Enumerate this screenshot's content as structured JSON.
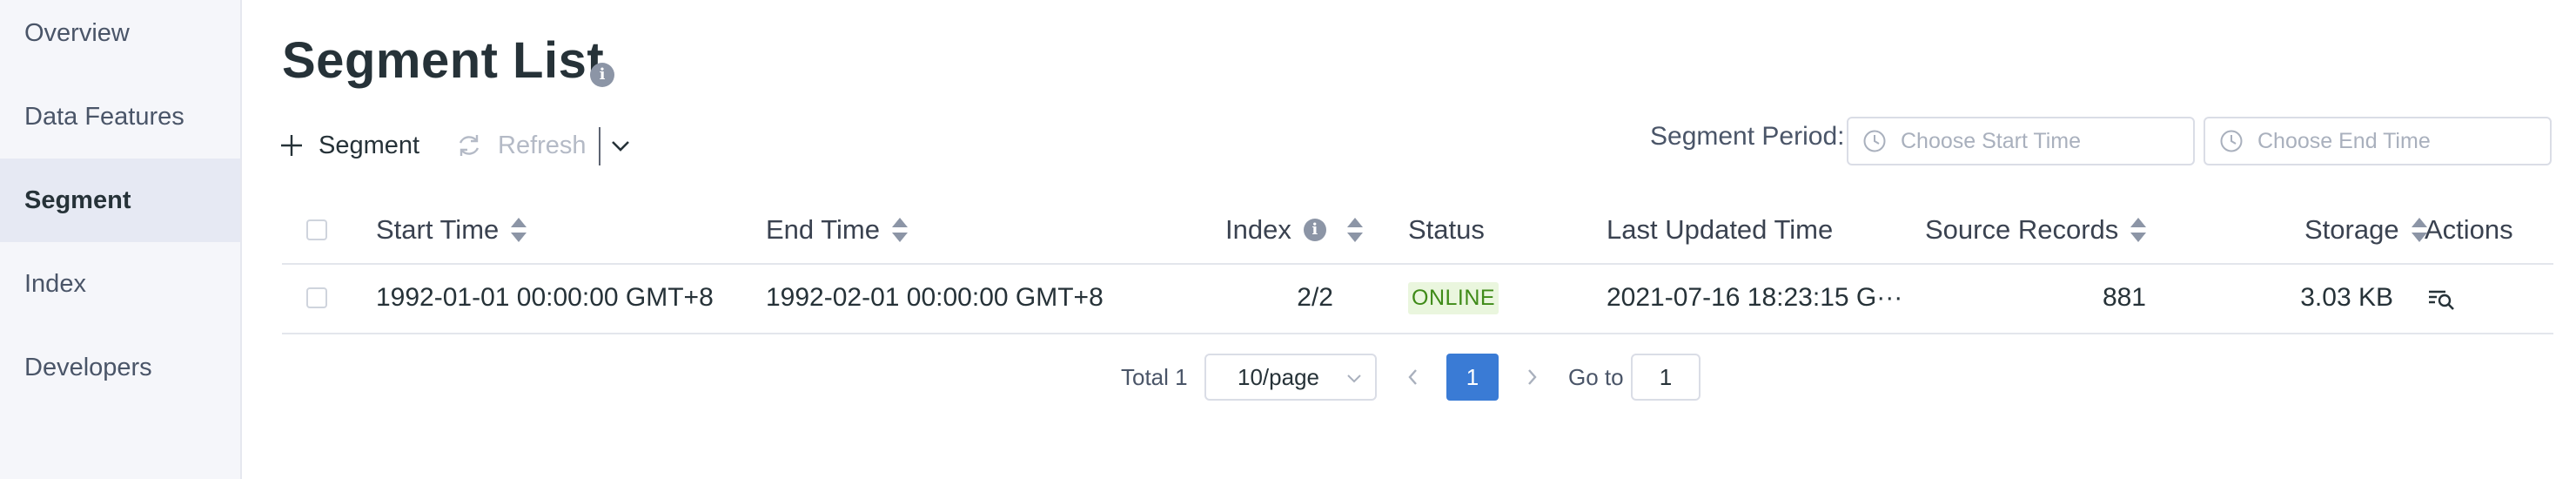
{
  "sidebar": {
    "items": [
      {
        "label": "Overview",
        "active": false
      },
      {
        "label": "Data Features",
        "active": false
      },
      {
        "label": "Segment",
        "active": true
      },
      {
        "label": "Index",
        "active": false
      },
      {
        "label": "Developers",
        "active": false
      }
    ]
  },
  "page": {
    "title": "Segment List",
    "info_icon_glyph": "i"
  },
  "toolbar": {
    "segment_label": "Segment",
    "refresh_label": "Refresh"
  },
  "period": {
    "label": "Segment Period:",
    "start_placeholder": "Choose Start Time",
    "end_placeholder": "Choose End Time"
  },
  "table": {
    "headers": {
      "start_time": "Start Time",
      "end_time": "End Time",
      "index": "Index",
      "status": "Status",
      "last_updated": "Last Updated Time",
      "source_records": "Source Records",
      "storage": "Storage",
      "actions": "Actions"
    },
    "rows": [
      {
        "start_time": "1992-01-01 00:00:00 GMT+8",
        "end_time": "1992-02-01 00:00:00 GMT+8",
        "index": "2/2",
        "status": "ONLINE",
        "last_updated": "2021-07-16 18:23:15 G···",
        "source_records": "881",
        "storage": "3.03 KB",
        "action_icon": "view-detail-icon"
      }
    ]
  },
  "pagination": {
    "total_label": "Total 1",
    "page_size": "10/page",
    "current_page": "1",
    "goto_label": "Go to",
    "goto_value": "1"
  },
  "colors": {
    "accent": "#3a7bd5",
    "status_online_bg": "#eaf6de",
    "status_online_text": "#3f8b18",
    "sidebar_bg": "#f5f6fa",
    "sidebar_active_bg": "#e6e9f3"
  }
}
